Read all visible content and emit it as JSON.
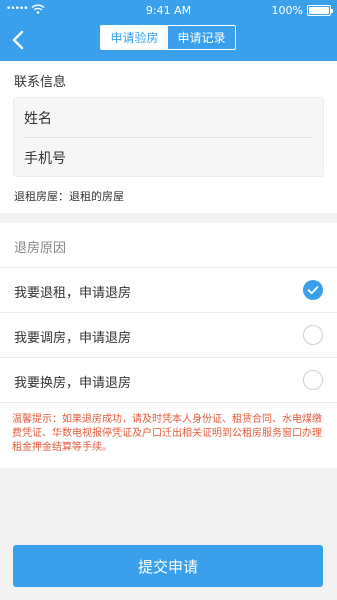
{
  "status_bar": {
    "signal": "•••••",
    "time": "9:41 AM",
    "battery_text": "100%",
    "battery_level": 1.0
  },
  "header": {
    "back_icon": "chevron-left-icon",
    "tabs": [
      {
        "label": "申请验房",
        "active": true
      },
      {
        "label": "申请记录",
        "active": false
      }
    ]
  },
  "contact": {
    "title": "联系信息",
    "name_label": "姓名",
    "phone_label": "手机号",
    "house_line": "退租房屋：退租的房屋"
  },
  "reason": {
    "title": "退房原因",
    "options": [
      {
        "label": "我要退租，申请退房",
        "checked": true
      },
      {
        "label": "我要调房，申请退房",
        "checked": false
      },
      {
        "label": "我要换房，申请退房",
        "checked": false
      }
    ],
    "tips": "温馨提示：如果退房成功，请及时凭本人身份证、租赁合同、水电煤缴费凭证、华数电视报停凭证及户口迁出相关证明到公租房服务窗口办理租金押金结算等手续。"
  },
  "submit": {
    "label": "提交申请"
  },
  "colors": {
    "primary": "#3aa0ec",
    "warning_text": "#e45a3b",
    "background": "#f2f2f2"
  }
}
